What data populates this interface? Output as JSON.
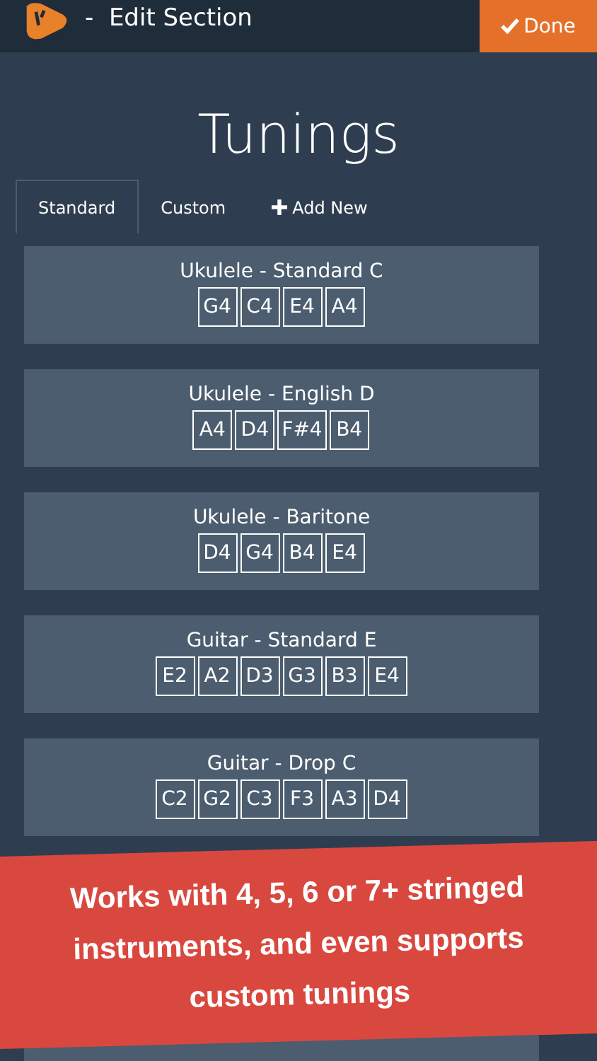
{
  "header": {
    "title": "-  Edit Section",
    "done_button": "Done"
  },
  "title": "Tunings",
  "tabs": [
    {
      "label": "Standard",
      "selected": true
    },
    {
      "label": "Custom",
      "selected": false
    },
    {
      "label": "Add New",
      "selected": false,
      "kind": "add"
    }
  ],
  "tunings": [
    {
      "name": "Ukulele - Standard C",
      "notes": [
        "G4",
        "C4",
        "E4",
        "A4"
      ]
    },
    {
      "name": "Ukulele - English D",
      "notes": [
        "A4",
        "D4",
        "F#4",
        "B4"
      ]
    },
    {
      "name": "Ukulele - Baritone",
      "notes": [
        "D4",
        "G4",
        "B4",
        "E4"
      ]
    },
    {
      "name": "Guitar - Standard E",
      "notes": [
        "E2",
        "A2",
        "D3",
        "G3",
        "B3",
        "E4"
      ]
    },
    {
      "name": "Guitar - Drop C",
      "notes": [
        "C2",
        "G2",
        "C3",
        "F3",
        "A3",
        "D4"
      ]
    }
  ],
  "banner": {
    "text": "Works with 4, 5, 6 or 7+ stringed instruments, and even supports custom tunings"
  }
}
